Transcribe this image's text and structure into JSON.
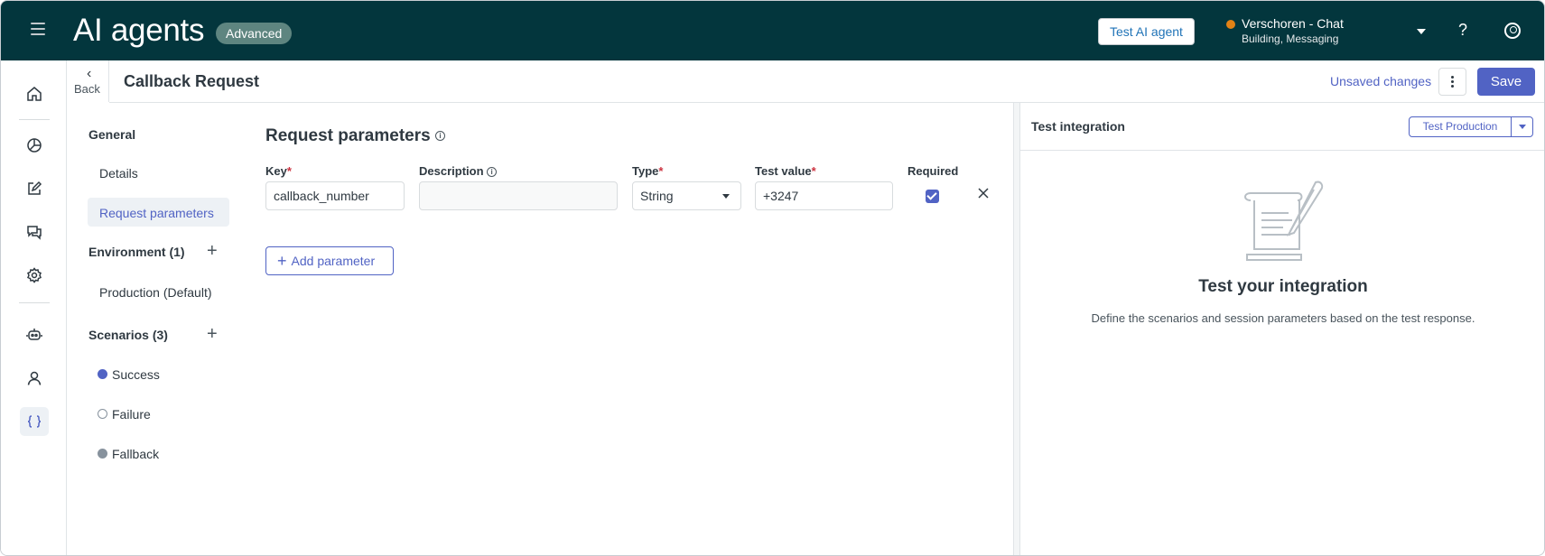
{
  "header": {
    "app_title": "AI agents",
    "badge": "Advanced",
    "test_agent_label": "Test AI agent",
    "account_name": "Verschoren - Chat",
    "account_sub": "Building, Messaging",
    "help_symbol": "?",
    "status_color": "#e38215"
  },
  "rail": {
    "items": [
      "home-icon",
      "analytics-icon",
      "edit-icon",
      "conversations-icon",
      "settings-icon",
      "bot-icon",
      "user-icon",
      "integrations-icon"
    ],
    "active": "integrations-icon"
  },
  "page": {
    "back_label": "Back",
    "title": "Callback Request",
    "unsaved_label": "Unsaved changes",
    "save_label": "Save"
  },
  "nav": {
    "general_heading": "General",
    "details": "Details",
    "request_parameters": "Request parameters",
    "environment_heading": "Environment (1)",
    "production": "Production (Default)",
    "scenarios_heading": "Scenarios (3)",
    "scenarios": [
      {
        "label": "Success",
        "color": "#5163c4"
      },
      {
        "label": "Failure",
        "color": "#ffffff"
      },
      {
        "label": "Fallback",
        "color": "#87929d"
      }
    ]
  },
  "main": {
    "section_title": "Request parameters",
    "columns": {
      "key": "Key",
      "description": "Description",
      "type": "Type",
      "test_value": "Test value",
      "required": "Required"
    },
    "required_mark": "*",
    "row": {
      "key": "callback_number",
      "description": "",
      "type": "String",
      "test_value": "+3247",
      "required": true
    },
    "add_parameter_label": "Add parameter"
  },
  "test_panel": {
    "title": "Test integration",
    "env_button": "Test Production",
    "empty_title": "Test your integration",
    "empty_desc": "Define the scenarios and session parameters based on the test response."
  },
  "colors": {
    "topbar": "#03363d",
    "accent": "#5163c4"
  }
}
